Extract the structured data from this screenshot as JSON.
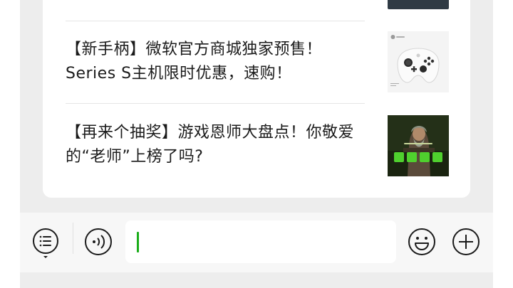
{
  "feed": {
    "articles": [
      {
        "title": "【新手柄】微软官方商城独家预售！Series S主机限时优惠，速购！"
      },
      {
        "title": "【再来个抽奖】游戏恩师大盘点！你敬爱的“老师”上榜了吗?"
      }
    ]
  },
  "icons": {
    "menu": "list-menu-icon",
    "voice": "voice-icon",
    "emoji": "emoji-icon",
    "plus": "plus-icon"
  },
  "colors": {
    "caret": "#1aad19",
    "background": "#ededed",
    "card": "#ffffff"
  }
}
